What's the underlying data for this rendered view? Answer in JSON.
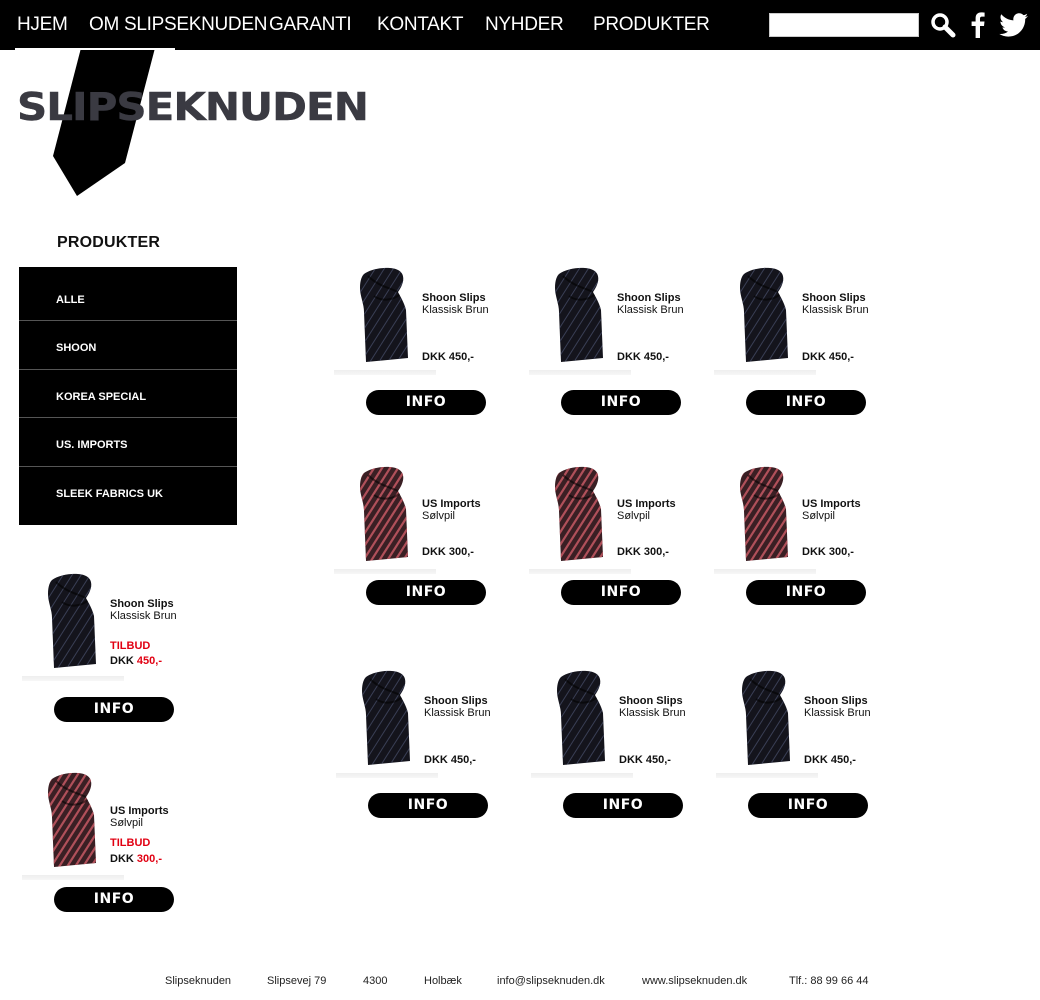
{
  "nav": {
    "items": [
      "HJEM",
      "OM SLIPSEKNUDEN",
      "GARANTI",
      "KONTAKT",
      "NYHDER",
      "PRODUKTER"
    ],
    "search_placeholder": "",
    "search_value": "",
    "icons": [
      "search-icon",
      "facebook-icon",
      "twitter-icon"
    ]
  },
  "logo": {
    "text": "SLIPSEKNUDEN"
  },
  "sidebar": {
    "heading": "PRODUKTER",
    "items": [
      {
        "label": "ALLE"
      },
      {
        "label": "SHOON"
      },
      {
        "label": "KOREA SPECIAL"
      },
      {
        "label": "US. IMPORTS"
      },
      {
        "label": "SLEEK FABRICS UK"
      }
    ],
    "offers": [
      {
        "name": "Shoon Slips",
        "sub": "Klassisk Brun",
        "offer_label": "TILBUD",
        "currency": "DKK",
        "price": "450,-",
        "tie": "navy",
        "button": "INFO"
      },
      {
        "name": "US Imports",
        "sub": "Sølvpil",
        "offer_label": "TILBUD",
        "currency": "DKK",
        "price": "300,-",
        "tie": "red",
        "button": "INFO"
      }
    ]
  },
  "products": [
    {
      "name": "Shoon Slips",
      "sub": "Klassisk Brun",
      "price": "DKK 450,-",
      "tie": "navy",
      "button": "INFO"
    },
    {
      "name": "Shoon Slips",
      "sub": "Klassisk Brun",
      "price": "DKK 450,-",
      "tie": "navy",
      "button": "INFO"
    },
    {
      "name": "Shoon Slips",
      "sub": "Klassisk Brun",
      "price": "DKK 450,-",
      "tie": "navy",
      "button": "INFO"
    },
    {
      "name": "US Imports",
      "sub": "Sølvpil",
      "price": "DKK 300,-",
      "tie": "red",
      "button": "INFO"
    },
    {
      "name": "US Imports",
      "sub": "Sølvpil",
      "price": "DKK 300,-",
      "tie": "red",
      "button": "INFO"
    },
    {
      "name": "US Imports",
      "sub": "Sølvpil",
      "price": "DKK 300,-",
      "tie": "red",
      "button": "INFO"
    },
    {
      "name": "Shoon Slips",
      "sub": "Klassisk Brun",
      "price": "DKK 450,-",
      "tie": "navy",
      "button": "INFO"
    },
    {
      "name": "Shoon Slips",
      "sub": "Klassisk Brun",
      "price": "DKK 450,-",
      "tie": "navy",
      "button": "INFO"
    },
    {
      "name": "Shoon Slips",
      "sub": "Klassisk Brun",
      "price": "DKK 450,-",
      "tie": "navy",
      "button": "INFO"
    }
  ],
  "footer": [
    "Slipseknuden",
    "Slipsevej 79",
    "4300",
    "Holbæk",
    "info@slipseknuden.dk",
    "www.slipseknuden.dk",
    "Tlf.: 88 99 66 44"
  ],
  "colors": {
    "nav_bg": "#000000",
    "accent_red": "#e10012",
    "logo_text": "#3a3a42",
    "tie_navy": "#14141c",
    "tie_red_stripe": "#b0505a"
  }
}
